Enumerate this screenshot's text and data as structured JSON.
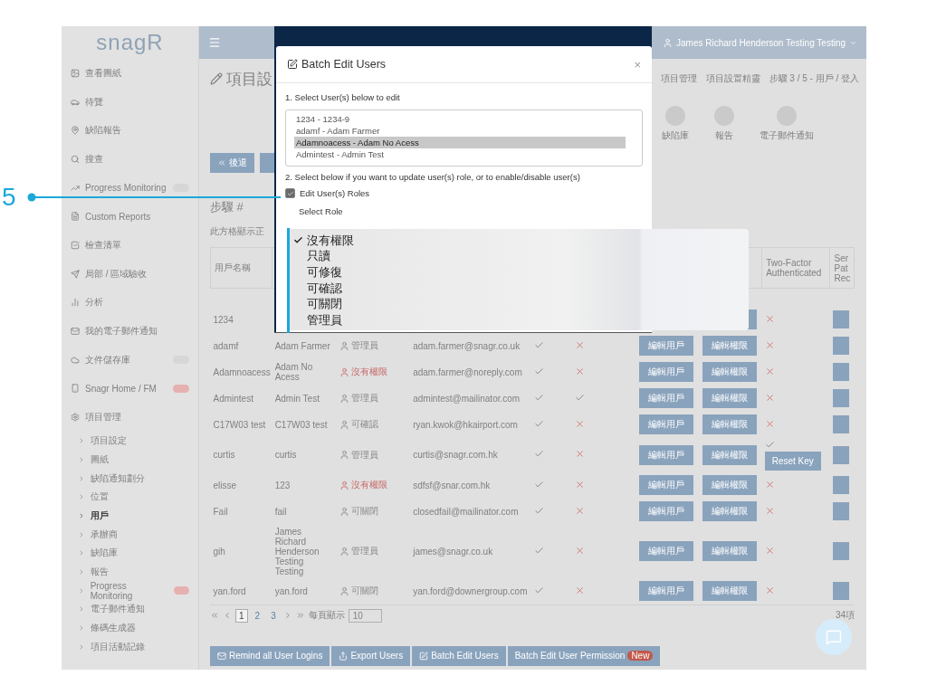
{
  "callout": {
    "number": "5"
  },
  "sidebar": {
    "logo": "snagR",
    "items": [
      {
        "label": "查看圖紙"
      },
      {
        "label": "待覽"
      },
      {
        "label": "缺陷報告"
      },
      {
        "label": "搜查"
      },
      {
        "label": "Progress Monitoring",
        "badge": {
          "color": "#d6d6d6"
        }
      },
      {
        "label": "Custom Reports"
      },
      {
        "label": "檢查清單"
      },
      {
        "label": "局部 / 區域驗收"
      },
      {
        "label": "分析"
      },
      {
        "label": "我的電子郵件通知"
      },
      {
        "label": "文件儲存庫",
        "badge": {
          "color": "#d6d6d6"
        }
      },
      {
        "label": "Snagr Home / FM",
        "badge": {
          "color": "#e6b0b0"
        }
      }
    ],
    "section": {
      "label": "項目管理",
      "children": [
        {
          "label": "項目設定",
          "selected": false
        },
        {
          "label": "圖紙",
          "selected": false
        },
        {
          "label": "缺陷通知劃分",
          "selected": false
        },
        {
          "label": "位置",
          "selected": false
        },
        {
          "label": "用戶",
          "selected": true
        },
        {
          "label": "承辦商",
          "selected": false
        },
        {
          "label": "缺陷庫",
          "selected": false
        },
        {
          "label": "報告",
          "selected": false
        },
        {
          "label": "Progress Monitoring",
          "selected": false,
          "badge": {
            "color": "#e6b0b0"
          }
        },
        {
          "label": "電子郵件通知",
          "selected": false
        },
        {
          "label": "條碼生成器",
          "selected": false
        },
        {
          "label": "項目活動記錄",
          "selected": false
        }
      ]
    }
  },
  "header": {
    "user": "James Richard Henderson Testing Testing"
  },
  "page": {
    "title": "項目設",
    "breadcrumb": [
      "項目管理",
      "項目設置精靈",
      "步驟 3 / 5 - 用戶 / 登入"
    ],
    "steps": [
      "缺陷庫",
      "報告",
      "電子郵件通知"
    ],
    "back_button": "後退",
    "step_heading": "步驟 #",
    "note": "此方格顯示正"
  },
  "table": {
    "columns": {
      "column_1": "用戶名稱",
      "column_9": "Two-Factor Authenticated",
      "column_10": "Ser Pat Rec"
    },
    "rows": [
      {
        "username": "1234",
        "two_factor": false
      },
      {
        "username": "adamf",
        "name": "Adam Farmer",
        "role": "管理員",
        "kind": "user",
        "email": "adam.farmer@snagr.co.uk",
        "verified": true,
        "active": false,
        "edit": "編輯用戶",
        "perm": "編輯權限",
        "two_factor": false
      },
      {
        "username": "Adamnoacess",
        "name": "Adam No Acess",
        "role": "沒有權限",
        "kind": "none",
        "email": "adam.farmer@noreply.com",
        "verified": true,
        "active": false,
        "edit": "編輯用戶",
        "perm": "編輯權限",
        "two_factor": false
      },
      {
        "username": "Admintest",
        "name": "Admin Test",
        "role": "管理員",
        "kind": "user",
        "email": "admintest@mailinator.com",
        "verified": true,
        "active": true,
        "edit": "編輯用戶",
        "perm": "編輯權限",
        "two_factor": false
      },
      {
        "username": "C17W03 test",
        "name": "C17W03 test",
        "role": "可確認",
        "kind": "user",
        "email": "ryan.kwok@hkairport.com",
        "verified": true,
        "active": false,
        "edit": "編輯用戶",
        "perm": "編輯權限",
        "two_factor": false
      },
      {
        "username": "curtis",
        "name": "curtis",
        "role": "管理員",
        "kind": "user",
        "email": "curtis@snagr.com.hk",
        "verified": true,
        "active": false,
        "edit": "編輯用戶",
        "perm": "編輯權限",
        "two_factor": true,
        "reset": "Reset Key"
      },
      {
        "username": "elisse",
        "name": "123",
        "role": "沒有權限",
        "kind": "none",
        "email": "sdfsf@snar.com.hk",
        "verified": true,
        "active": false,
        "edit": "編輯用戶",
        "perm": "編輯權限",
        "two_factor": false
      },
      {
        "username": "Fail",
        "name": "fail",
        "role": "可關閉",
        "kind": "user",
        "email": "closedfail@mailinator.com",
        "verified": true,
        "active": false,
        "edit": "編輯用戶",
        "perm": "編輯權限",
        "two_factor": false
      },
      {
        "username": "gih",
        "name": "James Richard Henderson Testing Testing",
        "role": "管理員",
        "kind": "user",
        "email": "james@snagr.co.uk",
        "verified": true,
        "active": false,
        "edit": "編輯用戶",
        "perm": "編輯權限",
        "two_factor": false
      },
      {
        "username": "yan.ford",
        "name": "yan.ford",
        "role": "可關閉",
        "kind": "user",
        "email": "yan.ford@downergroup.com",
        "verified": true,
        "active": false,
        "edit": "編輯用戶",
        "perm": "編輯權限",
        "two_factor": false
      }
    ]
  },
  "pagination": {
    "pages": [
      {
        "label": "1",
        "selected": true
      },
      {
        "label": "2",
        "selected": false
      },
      {
        "label": "3",
        "selected": false
      }
    ],
    "per_page_label": "每頁顯示",
    "per_page": "10",
    "total": "34項"
  },
  "actions": [
    {
      "label": "Remind all User Logins",
      "kind": "mail"
    },
    {
      "label": "Export Users",
      "kind": "share"
    },
    {
      "label": "Batch Edit Users",
      "kind": "edit"
    },
    {
      "label": "Batch Edit User Permission",
      "kind": "plain",
      "badge": "New"
    }
  ],
  "modal": {
    "title": "Batch Edit Users",
    "close": "×",
    "step1": "1. Select User(s) below to edit",
    "users": [
      {
        "label": "1234 - 1234-9",
        "selected": false
      },
      {
        "label": "adamf - Adam Farmer",
        "selected": false
      },
      {
        "label": "Adamnoacess - Adam No Acess",
        "selected": true
      },
      {
        "label": "Admintest - Admin Test",
        "selected": false
      }
    ],
    "step2": "2. Select below if you want to update user(s) role, or to enable/disable user(s)",
    "edit_roles": {
      "label": "Edit User(s) Roles",
      "checked": true
    },
    "select_role": "Select Role"
  },
  "role_menu": [
    {
      "label": "沒有權限",
      "selected": true
    },
    {
      "label": "只讀",
      "selected": false
    },
    {
      "label": "可修復",
      "selected": false
    },
    {
      "label": "可確認",
      "selected": false
    },
    {
      "label": "可關閉",
      "selected": false
    },
    {
      "label": "管理員",
      "selected": false
    }
  ]
}
